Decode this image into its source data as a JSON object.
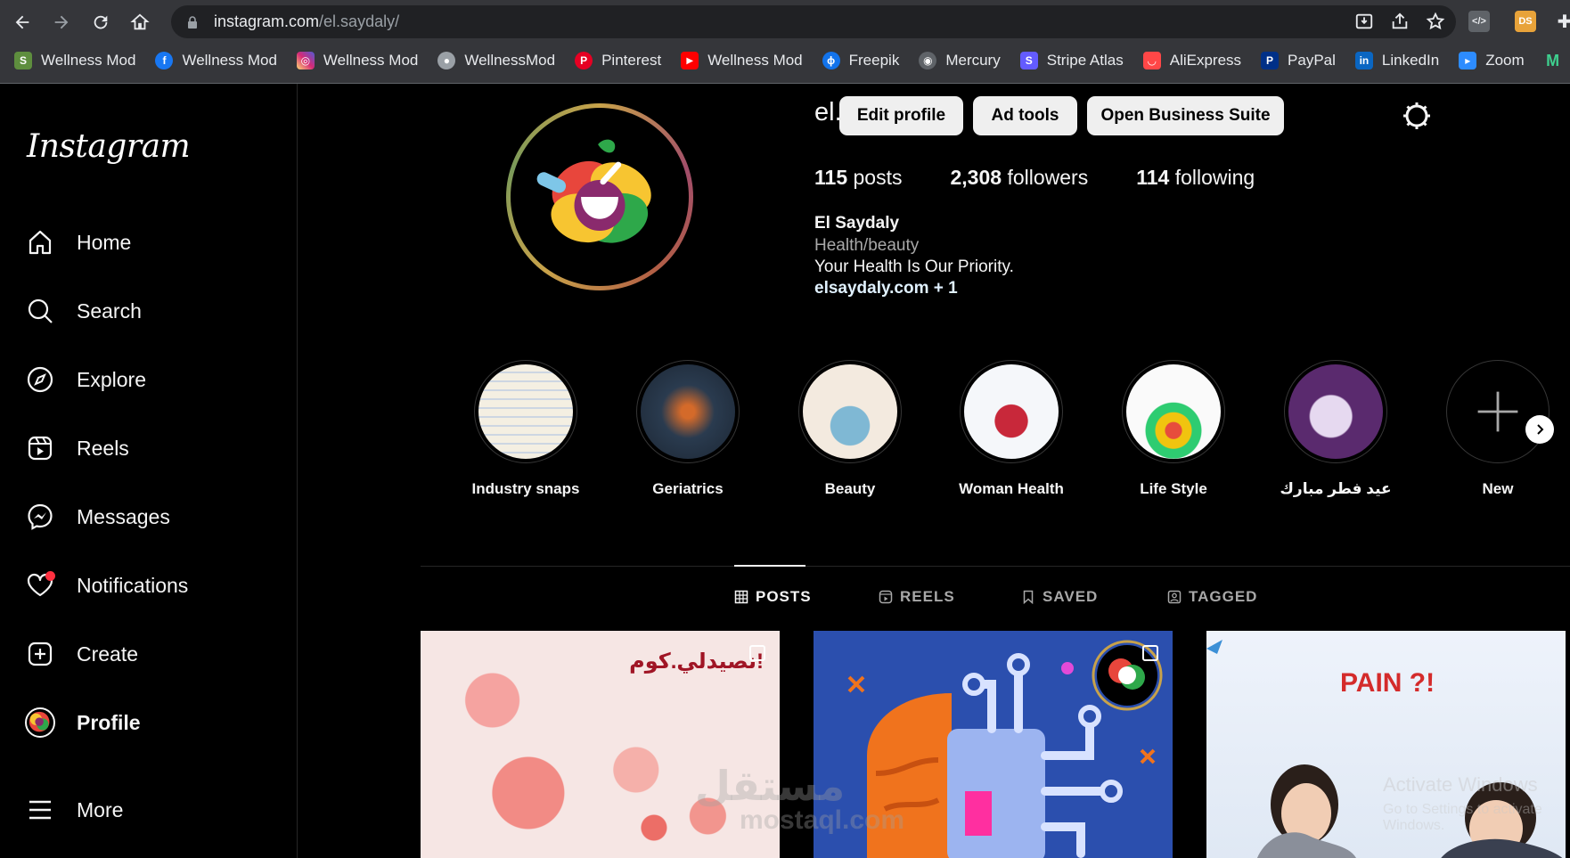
{
  "browser": {
    "url_host": "instagram.com",
    "url_path": "/el.saydaly/",
    "bookmarks": [
      {
        "label": "Wellness Mod",
        "icon": "shopify-icon",
        "color": "#5e8e3e"
      },
      {
        "label": "Wellness Mod",
        "icon": "facebook-icon",
        "color": "#1877f2"
      },
      {
        "label": "Wellness Mod",
        "icon": "instagram-icon",
        "color": "#d62976"
      },
      {
        "label": "WellnessMod",
        "icon": "globe-icon",
        "color": "#9aa0a6"
      },
      {
        "label": "Pinterest",
        "icon": "pinterest-icon",
        "color": "#e60023"
      },
      {
        "label": "Wellness Mod",
        "icon": "youtube-icon",
        "color": "#ff0000"
      },
      {
        "label": "Freepik",
        "icon": "freepik-icon",
        "color": "#1273eb"
      },
      {
        "label": "Mercury",
        "icon": "mercury-icon",
        "color": "#9aa0a6"
      },
      {
        "label": "Stripe Atlas",
        "icon": "stripe-icon",
        "color": "#635bff"
      },
      {
        "label": "AliExpress",
        "icon": "aliexpress-icon",
        "color": "#ff4747"
      },
      {
        "label": "PayPal",
        "icon": "paypal-icon",
        "color": "#003087"
      },
      {
        "label": "LinkedIn",
        "icon": "linkedin-icon",
        "color": "#0a66c2"
      },
      {
        "label": "Zoom",
        "icon": "zoom-icon",
        "color": "#2d8cff"
      }
    ],
    "extension_ds_label": "DS"
  },
  "sidebar": {
    "logo": "Instagram",
    "items": [
      {
        "label": "Home",
        "icon": "home-icon"
      },
      {
        "label": "Search",
        "icon": "search-icon"
      },
      {
        "label": "Explore",
        "icon": "compass-icon"
      },
      {
        "label": "Reels",
        "icon": "reels-icon"
      },
      {
        "label": "Messages",
        "icon": "messenger-icon"
      },
      {
        "label": "Notifications",
        "icon": "heart-icon"
      },
      {
        "label": "Create",
        "icon": "plus-square-icon"
      },
      {
        "label": "Profile",
        "icon": "avatar-icon"
      },
      {
        "label": "More",
        "icon": "menu-icon"
      }
    ]
  },
  "profile": {
    "username": "el.saydaly",
    "buttons": {
      "edit": "Edit profile",
      "ad_tools": "Ad tools",
      "business": "Open Business Suite"
    },
    "stats": {
      "posts_count": "115",
      "posts_label": "posts",
      "followers_count": "2,308",
      "followers_label": "followers",
      "following_count": "114",
      "following_label": "following"
    },
    "bio": {
      "name": "El Saydaly",
      "category": "Health/beauty",
      "text": "Your Health Is Our Priority.",
      "link": "elsaydaly.com + 1"
    }
  },
  "highlights": [
    {
      "label": "Industry snaps"
    },
    {
      "label": "Geriatrics"
    },
    {
      "label": "Beauty"
    },
    {
      "label": "Woman Health"
    },
    {
      "label": "Life Style"
    },
    {
      "label": "عيد فطر مبارك"
    },
    {
      "label": "New"
    }
  ],
  "tabs": [
    {
      "label": "POSTS",
      "icon": "grid-icon"
    },
    {
      "label": "REELS",
      "icon": "reels-icon"
    },
    {
      "label": "SAVED",
      "icon": "bookmark-icon"
    },
    {
      "label": "TAGGED",
      "icon": "tag-icon"
    }
  ],
  "posts": {
    "post1_text": "نصيدلي.كوم!",
    "post3_text": "PAIN ?!"
  },
  "overlays": {
    "windows_line1": "Activate Windows",
    "windows_line2": "Go to Settings to activate Windows.",
    "watermark_arabic": "مستقل",
    "watermark_latin": "mostaql.com"
  }
}
